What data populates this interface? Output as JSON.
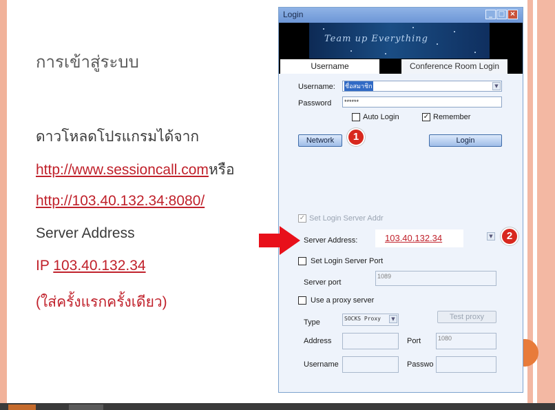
{
  "slide": {
    "title": "การเข้าสู่ระบบ",
    "download_text": "ดาวโหลดโปรแกรมได้จาก",
    "link1": "http://www.sessioncall.com",
    "link1_suffix": "หรือ",
    "link2": "http://103.40.132.34:8080/",
    "server_address_label": "Server Address",
    "ip_prefix": "IP ",
    "ip_value": "103.40.132.34",
    "note": "(ใส่ครั้งแรกครั้งเดียว)"
  },
  "window": {
    "title": "Login",
    "banner_text": "Team up Everything",
    "tabs": [
      "Username",
      "Conference Room Login"
    ],
    "form": {
      "username_label": "Username:",
      "username_value": "ชื่อสมาชิก",
      "password_label": "Password",
      "password_value": "******",
      "auto_login_label": "Auto Login",
      "auto_login_checked": false,
      "remember_label": "Remember",
      "remember_checked": true,
      "network_button": "Network",
      "login_button": "Login",
      "set_login_server_addr_label": "Set Login Server Addr",
      "set_login_server_addr_checked": true,
      "server_address_label": "Server Address:",
      "server_address_value": "103.40.132.34",
      "set_login_server_port_label": "Set Login Server Port",
      "server_port_label": "Server port",
      "server_port_value": "1089",
      "use_proxy_label": "Use a proxy server",
      "type_label": "Type",
      "type_value": "SOCKS Proxy",
      "test_proxy_button": "Test proxy",
      "address_label": "Address",
      "port_label": "Port",
      "port_value": "1080",
      "proxy_username_label": "Username",
      "proxy_password_label": "Passwo"
    }
  },
  "annotations": {
    "badge1": "1",
    "badge2": "2",
    "accent_red": "#d8281e",
    "arrow_color": "#e8101a"
  }
}
